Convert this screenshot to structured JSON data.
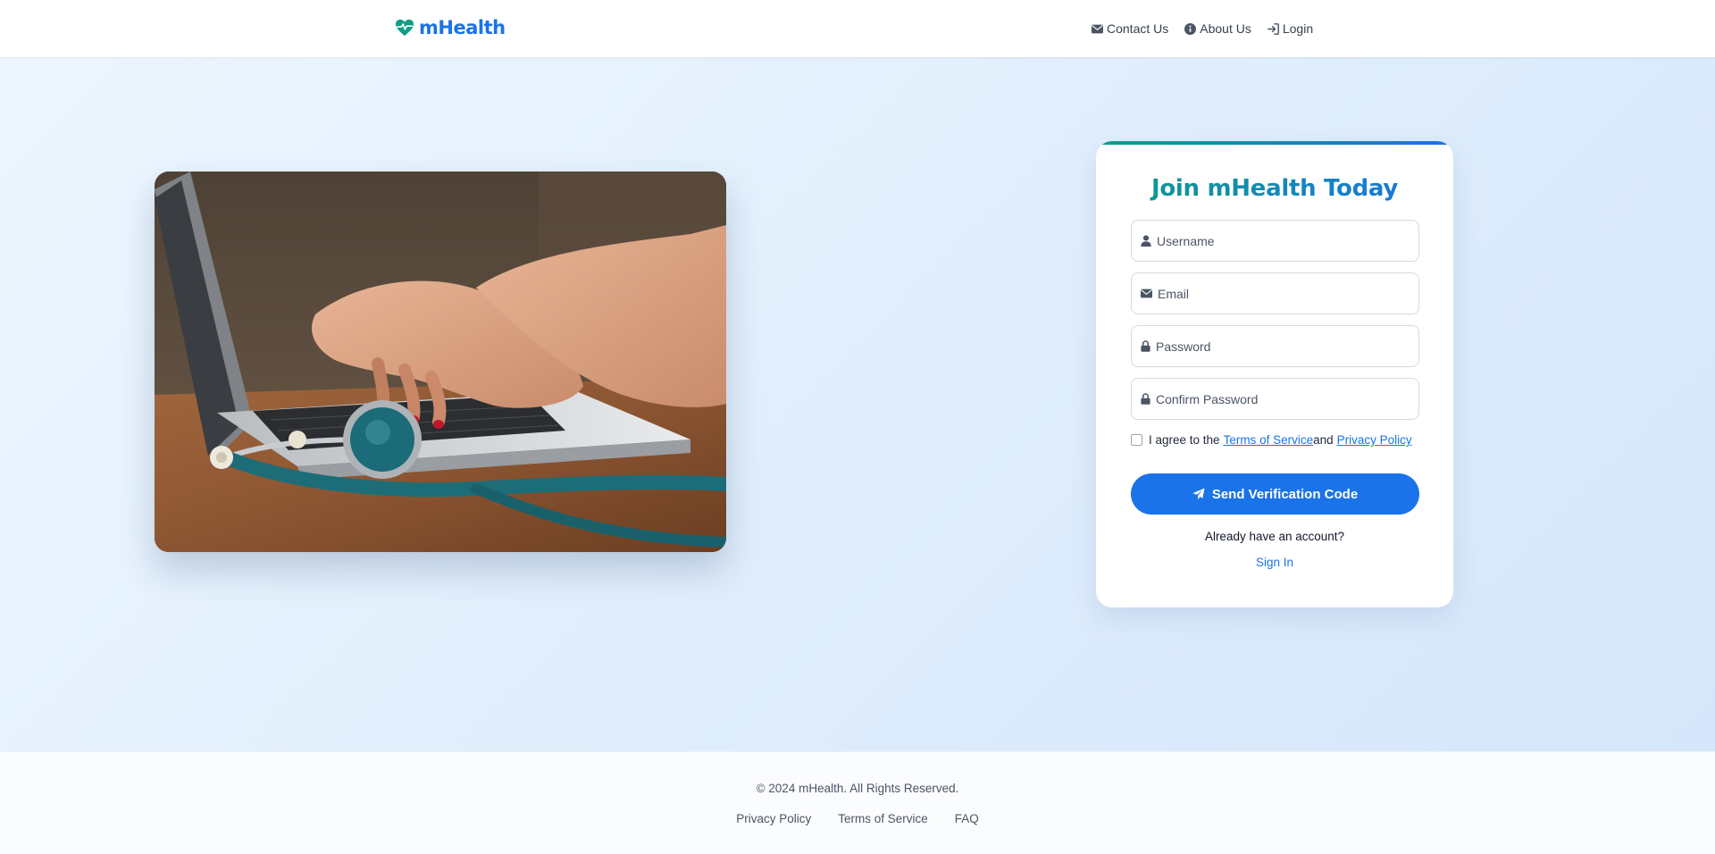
{
  "header": {
    "logo_text": "mHealth",
    "logo_icon": "heart-pulse-icon",
    "brand_color": "#1a73e8",
    "logo_icon_color": "#0f9d86",
    "nav": [
      {
        "label": "Contact Us",
        "icon": "envelope-icon"
      },
      {
        "label": "About Us",
        "icon": "info-circle-icon"
      },
      {
        "label": "Login",
        "icon": "sign-in-icon"
      }
    ]
  },
  "hero": {
    "image_description": "hands typing on laptop with stethoscope"
  },
  "signup": {
    "title": "Join mHealth Today",
    "fields": {
      "username": {
        "placeholder": "Username",
        "icon": "user-icon"
      },
      "email": {
        "placeholder": "Email",
        "icon": "envelope-icon"
      },
      "password": {
        "placeholder": "Password",
        "icon": "lock-icon"
      },
      "confirm_password": {
        "placeholder": "Confirm Password",
        "icon": "lock-icon"
      }
    },
    "agree": {
      "prefix": "I agree to the",
      "terms": "Terms of Service",
      "and": "and",
      "privacy": "Privacy Policy",
      "checked": false
    },
    "submit_label": "Send Verification Code",
    "submit_icon": "paper-plane-icon",
    "already_text": "Already have an account?",
    "signin_label": "Sign In"
  },
  "footer": {
    "copyright": "© 2024 mHealth. All Rights Reserved.",
    "links": [
      "Privacy Policy",
      "Terms of Service",
      "FAQ"
    ]
  }
}
